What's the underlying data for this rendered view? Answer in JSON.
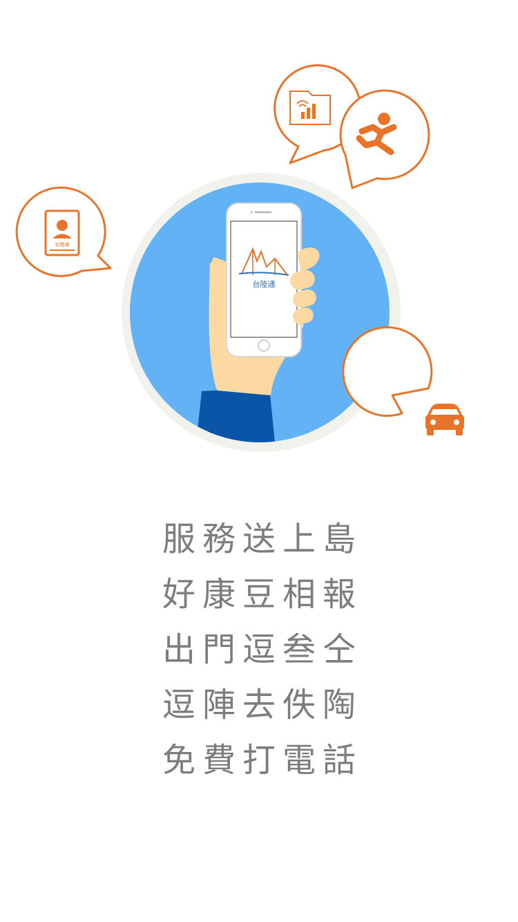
{
  "app": {
    "phone_logo_text": "台陸通",
    "contact_card_label": "台陸通"
  },
  "colors": {
    "accent": "#e8742a",
    "circle_blue": "#63b2f5",
    "circle_border": "#f1f2ec",
    "slogan_text": "#7d7d7d",
    "sleeve": "#0a55a8",
    "skin": "#fcd8a2"
  },
  "icons": {
    "contact": "contact-card-icon",
    "signal": "signal-folder-icon",
    "runner": "running-person-icon",
    "car": "car-icon"
  },
  "slogan": {
    "lines": [
      "服務送上島",
      "好康豆相報",
      "出門逗叁仝",
      "逗陣去佚陶",
      "免費打電話"
    ]
  }
}
